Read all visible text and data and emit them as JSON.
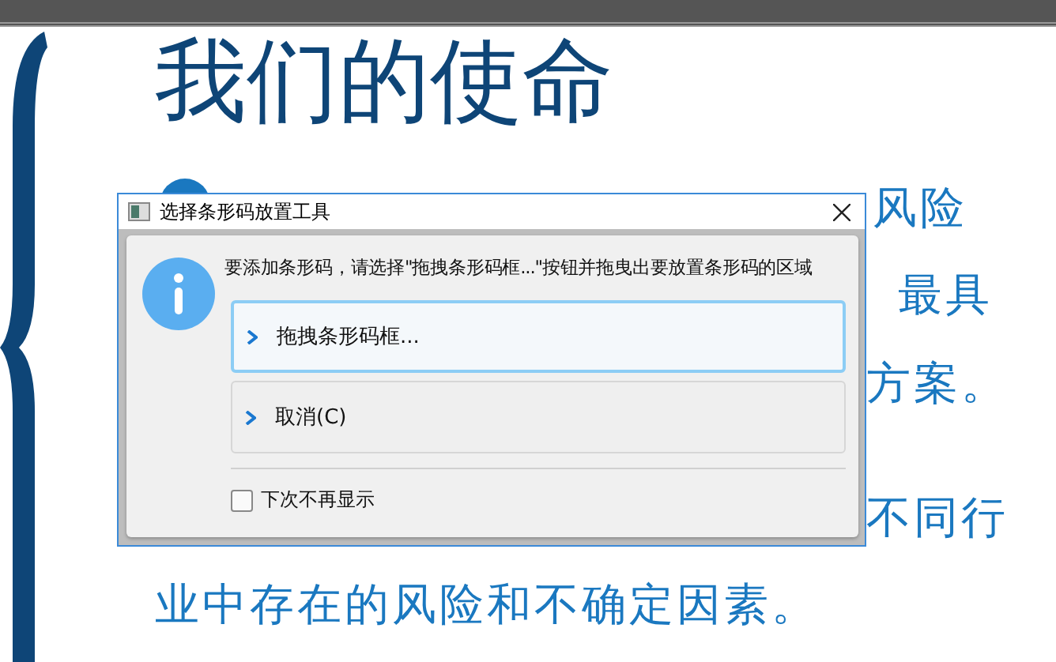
{
  "slide": {
    "title": "我们的使命",
    "fragments": [
      "风险",
      "最具",
      "方案。",
      "不同行",
      "业中存在的风险和不确定因素。"
    ]
  },
  "dialog": {
    "title": "选择条形码放置工具",
    "message": "要添加条形码，请选择\"拖拽条形码框...\"按钮并拖曳出要放置条形码的区域",
    "options": [
      {
        "label": "拖拽条形码框...",
        "selected": true
      },
      {
        "label": "取消(C)",
        "selected": false
      }
    ],
    "checkbox": {
      "label": "下次不再显示",
      "checked": false
    }
  }
}
